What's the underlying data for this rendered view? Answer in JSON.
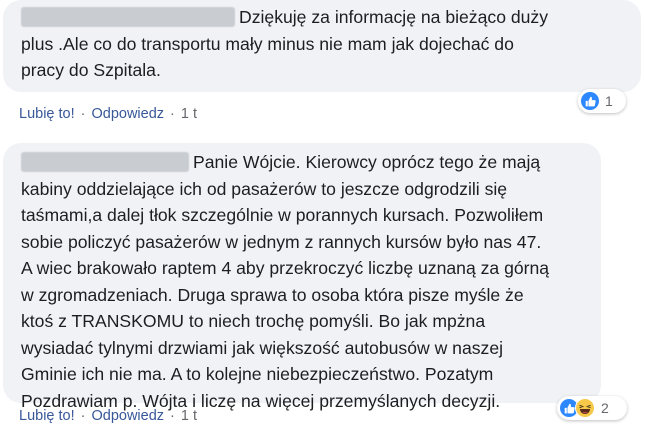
{
  "comments": [
    {
      "text": "Dziękuję za informację na bieżąco duży\nplus .Ale co do transportu mały minus nie mam jak dojechać do\npracy do Szpitala.",
      "actions": {
        "like": "Lubię to!",
        "reply": "Odpowiedz",
        "time": "1 t"
      },
      "reactions": {
        "icons": [
          "like-icon"
        ],
        "count": "1"
      }
    },
    {
      "text": "Panie Wójcie. Kierowcy oprócz tego że mają\nkabiny oddzielające ich od pasażerów to jeszcze odgrodzili się\ntaśmami,a dalej tłok szczególnie w porannych kursach. Pozwoliłem\nsobie policzyć pasażerów w jednym z rannych kursów było nas 47.\nA wiec brakowało raptem 4 aby przekroczyć liczbę uznaną za górną\nw zgromadzeniach. Druga sprawa to osoba która pisze myśle że\nktoś z TRANSKOMU to niech trochę pomyśli. Bo jak mpżna\nwysiadać tylnymi drzwiami jak większość autobusów w naszej\nGminie ich nie ma. A to kolejne niebezpieczeństwo. Pozatym\nPozdrawiam p. Wójta i liczę na więcej przemyślanych decyzji.",
      "actions": {
        "like": "Lubię to!",
        "reply": "Odpowiedz",
        "time": "1 t"
      },
      "reactions": {
        "icons": [
          "like-icon",
          "haha-icon"
        ],
        "count": "2"
      }
    }
  ],
  "colors": {
    "bubble": "#f0f2f5",
    "link": "#385898",
    "meta": "#65676b",
    "like": "#2d88ff",
    "haha": "#f7c94b"
  }
}
